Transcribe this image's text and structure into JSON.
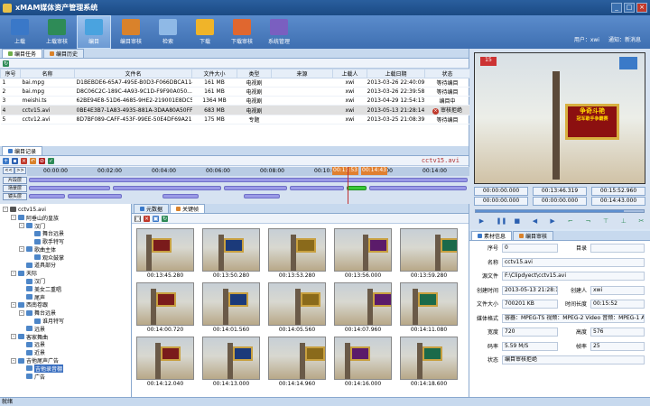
{
  "app": {
    "title": "xMAM媒体资产管理系统",
    "window_controls": [
      "_",
      "□",
      "×"
    ]
  },
  "toolbar": {
    "buttons": [
      {
        "label": "上载",
        "color": "#3a78c8"
      },
      {
        "label": "上载审核",
        "color": "#2e8b57"
      },
      {
        "label": "编目",
        "color": "#4aa3df"
      },
      {
        "label": "编目审核",
        "color": "#d9822b"
      },
      {
        "label": "检索",
        "color": "#8fb9e6"
      },
      {
        "label": "下载",
        "color": "#f0b429"
      },
      {
        "label": "下载审核",
        "color": "#e0672f"
      },
      {
        "label": "系统管理",
        "color": "#7a5fc0"
      }
    ],
    "active_index": 2,
    "user_label": "用户：",
    "user_value": "xwi",
    "notice_label": "通知：",
    "notice_value": "新消息"
  },
  "task_tabs": [
    "编目任务",
    "编目历史"
  ],
  "task_table": {
    "headers": [
      "序号",
      "名称",
      "文件名",
      "文件大小",
      "类型",
      "来源",
      "上载人",
      "上载日期",
      "状态"
    ],
    "rows": [
      {
        "no": "1",
        "name": "bai.mpg",
        "file": "D1BEBDE6-65A7-495E-B0D3-F066DBCA1144",
        "size": "161 MB",
        "type": "电视剧",
        "source": "",
        "uploader": "xwi",
        "date": "2013-03-26 22:40:09",
        "status": "等待编目",
        "error": false
      },
      {
        "no": "2",
        "name": "bai.mpg",
        "file": "D8C06C2C-189C-4A93-9C1D-F9F90A050...",
        "size": "161 MB",
        "type": "电视剧",
        "source": "",
        "uploader": "xwi",
        "date": "2013-03-26 22:39:58",
        "status": "等待编目",
        "error": false
      },
      {
        "no": "3",
        "name": "meishi.ts",
        "file": "62BE94E8-51D6-4685-9HE2-219001E8DC53",
        "size": "1364 MB",
        "type": "电视剧",
        "source": "",
        "uploader": "xwi",
        "date": "2013-04-29 12:54:13",
        "status": "编目中",
        "error": false
      },
      {
        "no": "4",
        "name": "cctv15.avi",
        "file": "0BE4E3B7-1A83-4935-881A-3DAA80A50FFD",
        "size": "683 MB",
        "type": "电视剧",
        "source": "",
        "uploader": "xwi",
        "date": "2013-05-13 21:28:14",
        "status": "审核拒绝",
        "error": true
      },
      {
        "no": "5",
        "name": "cctv12.avi",
        "file": "8D7BF089-CAFF-453F-99EE-50E4DF69A216",
        "size": "175 MB",
        "type": "专题",
        "source": "",
        "uploader": "xwi",
        "date": "2013-03-25 21:08:39",
        "status": "等待编目",
        "error": false
      }
    ],
    "selected_index": 3
  },
  "record": {
    "tab": "编目记录",
    "file_label": "cctv15.avi",
    "nav": [
      "<<",
      ">>"
    ],
    "ruler": [
      "00:00:00",
      "00:02:00",
      "00:04:00",
      "00:06:00",
      "00:08:00",
      "00:10:00",
      "00:12:00",
      "00:14:00"
    ],
    "ruler_highlight": "00:13:53",
    "ruler_highlight2": "00:14:43",
    "rows": [
      "片段层",
      "场景层",
      "镜头层"
    ]
  },
  "tree": {
    "nodes": [
      {
        "label": "cctv15.avi",
        "level": 0,
        "toggle": "-"
      },
      {
        "label": "阿垂山的皇族",
        "level": 1,
        "toggle": "-"
      },
      {
        "label": "汉门",
        "level": 2,
        "toggle": "-"
      },
      {
        "label": "舞台远景",
        "level": 3,
        "toggle": ""
      },
      {
        "label": "歌手特写",
        "level": 3,
        "toggle": ""
      },
      {
        "label": "歌曲主体",
        "level": 2,
        "toggle": "-"
      },
      {
        "label": "观众鼓掌",
        "level": 3,
        "toggle": ""
      },
      {
        "label": "道具部分",
        "level": 2,
        "toggle": ""
      },
      {
        "label": "天际",
        "level": 1,
        "toggle": "-"
      },
      {
        "label": "汉门",
        "level": 2,
        "toggle": ""
      },
      {
        "label": "美女二重唱",
        "level": 2,
        "toggle": ""
      },
      {
        "label": "尾声",
        "level": 2,
        "toggle": ""
      },
      {
        "label": "西南卷跟",
        "level": 1,
        "toggle": "-"
      },
      {
        "label": "舞台远景",
        "level": 2,
        "toggle": "-"
      },
      {
        "label": "谁月特写",
        "level": 3,
        "toggle": ""
      },
      {
        "label": "远景",
        "level": 2,
        "toggle": ""
      },
      {
        "label": "客家舞曲",
        "level": 1,
        "toggle": "-"
      },
      {
        "label": "远景",
        "level": 2,
        "toggle": ""
      },
      {
        "label": "近景",
        "level": 2,
        "toggle": ""
      },
      {
        "label": "吉他尾声广告",
        "level": 1,
        "toggle": "-"
      },
      {
        "label": "吉他录音棚",
        "level": 2,
        "toggle": "",
        "selected": true
      },
      {
        "label": "广告",
        "level": 2,
        "toggle": ""
      }
    ]
  },
  "keyframes": {
    "tabs": [
      "元数据",
      "关键帧"
    ],
    "active_tab": 1,
    "times": [
      "00:13:45.280",
      "00:13:50.280",
      "00:13:53.280",
      "00:13:56.000",
      "00:13:59.280",
      "00:14:00.720",
      "00:14:01.560",
      "00:14:05.560",
      "00:14:07.960",
      "00:14:11.080",
      "00:14:12.040",
      "00:14:13.000",
      "00:14:14.960",
      "00:14:16.000",
      "00:14:18.600"
    ]
  },
  "preview": {
    "overlay_text": [
      "争奇斗艳",
      "冠军歌手争霸赛"
    ],
    "timecodes": [
      "00:00:00.000",
      "00:13:46.319",
      "00:15:52.960",
      "00:00:00.000",
      "00:00:00.000",
      "00:14:43.000"
    ],
    "progress": 0.88
  },
  "material": {
    "tabs": [
      "素材信息",
      "编目审核"
    ],
    "fields": [
      {
        "label": "序号",
        "value": "0",
        "label2": "目录",
        "value2": ""
      },
      {
        "label": "名称",
        "value": "cctv15.avi"
      },
      {
        "label": "源文件",
        "value": "F:\\Clipdyect\\cctv15.avi"
      },
      {
        "label": "创建时间",
        "value": "2013-05-13 21:28:14",
        "label2": "创建人",
        "value2": "xwi"
      },
      {
        "label": "文件大小",
        "value": "700201 KB",
        "label2": "时间长度",
        "value2": "00:15:52"
      },
      {
        "label": "媒体格式",
        "value": "容器：MPEG-TS 视频：MPEG-2 Video 音频：MPEG-1 Audio lay"
      },
      {
        "label": "宽度",
        "value": "720",
        "label2": "高度",
        "value2": "576"
      },
      {
        "label": "码率",
        "value": "5.59 M/S",
        "label2": "帧率",
        "value2": "25"
      },
      {
        "label": "状态",
        "value": "编目审核拒绝"
      }
    ]
  },
  "status": {
    "text": "就绪"
  }
}
